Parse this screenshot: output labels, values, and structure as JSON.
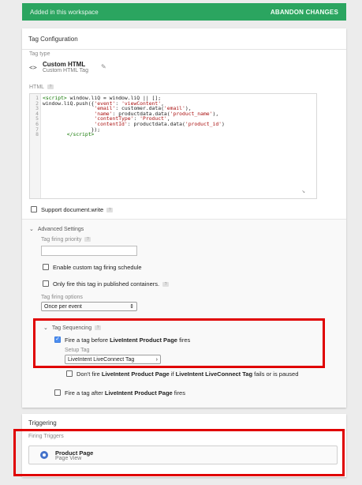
{
  "topbar": {
    "status": "Added in this workspace",
    "abandon_label": "ABANDON CHANGES"
  },
  "tag_config": {
    "title": "Tag Configuration",
    "tag_type_label": "Tag type",
    "tag_type_name": "Custom HTML",
    "tag_type_sub": "Custom HTML Tag",
    "tag_type_icon": "<>",
    "html_label": "HTML",
    "code_lines": [
      "1",
      "2",
      "3",
      "4",
      "5",
      "6",
      "7",
      "8"
    ],
    "support_docwrite_label": "Support document.write"
  },
  "advanced": {
    "title": "Advanced Settings",
    "priority_label": "Tag firing priority",
    "priority_value": "",
    "custom_schedule_label": "Enable custom tag firing schedule",
    "published_only_label": "Only fire this tag in published containers.",
    "firing_options_label": "Tag firing options",
    "firing_options_value": "Once per event",
    "sequencing": {
      "title": "Tag Sequencing",
      "before_prefix": "Fire a tag before ",
      "before_tag": "LiveIntent Product Page",
      "before_suffix": " fires",
      "setup_label": "Setup Tag",
      "setup_value": "LiveIntent LiveConnect Tag",
      "dont_fire_1": "Don't fire ",
      "dont_fire_tag1": "LiveIntent Product Page",
      "dont_fire_2": " if ",
      "dont_fire_tag2": "LiveIntent LiveConnect Tag",
      "dont_fire_3": " fails or is paused",
      "after_prefix": "Fire a tag after ",
      "after_tag": "LiveIntent Product Page",
      "after_suffix": " fires"
    }
  },
  "triggering": {
    "title": "Triggering",
    "firing_label": "Firing Triggers",
    "trigger_name": "Product Page",
    "trigger_type": "Page View",
    "trigger_color": "#4472ca"
  },
  "colors": {
    "accent_green": "#2ba560",
    "highlight_red": "#e00000",
    "checkbox_blue": "#4d8ef0"
  }
}
